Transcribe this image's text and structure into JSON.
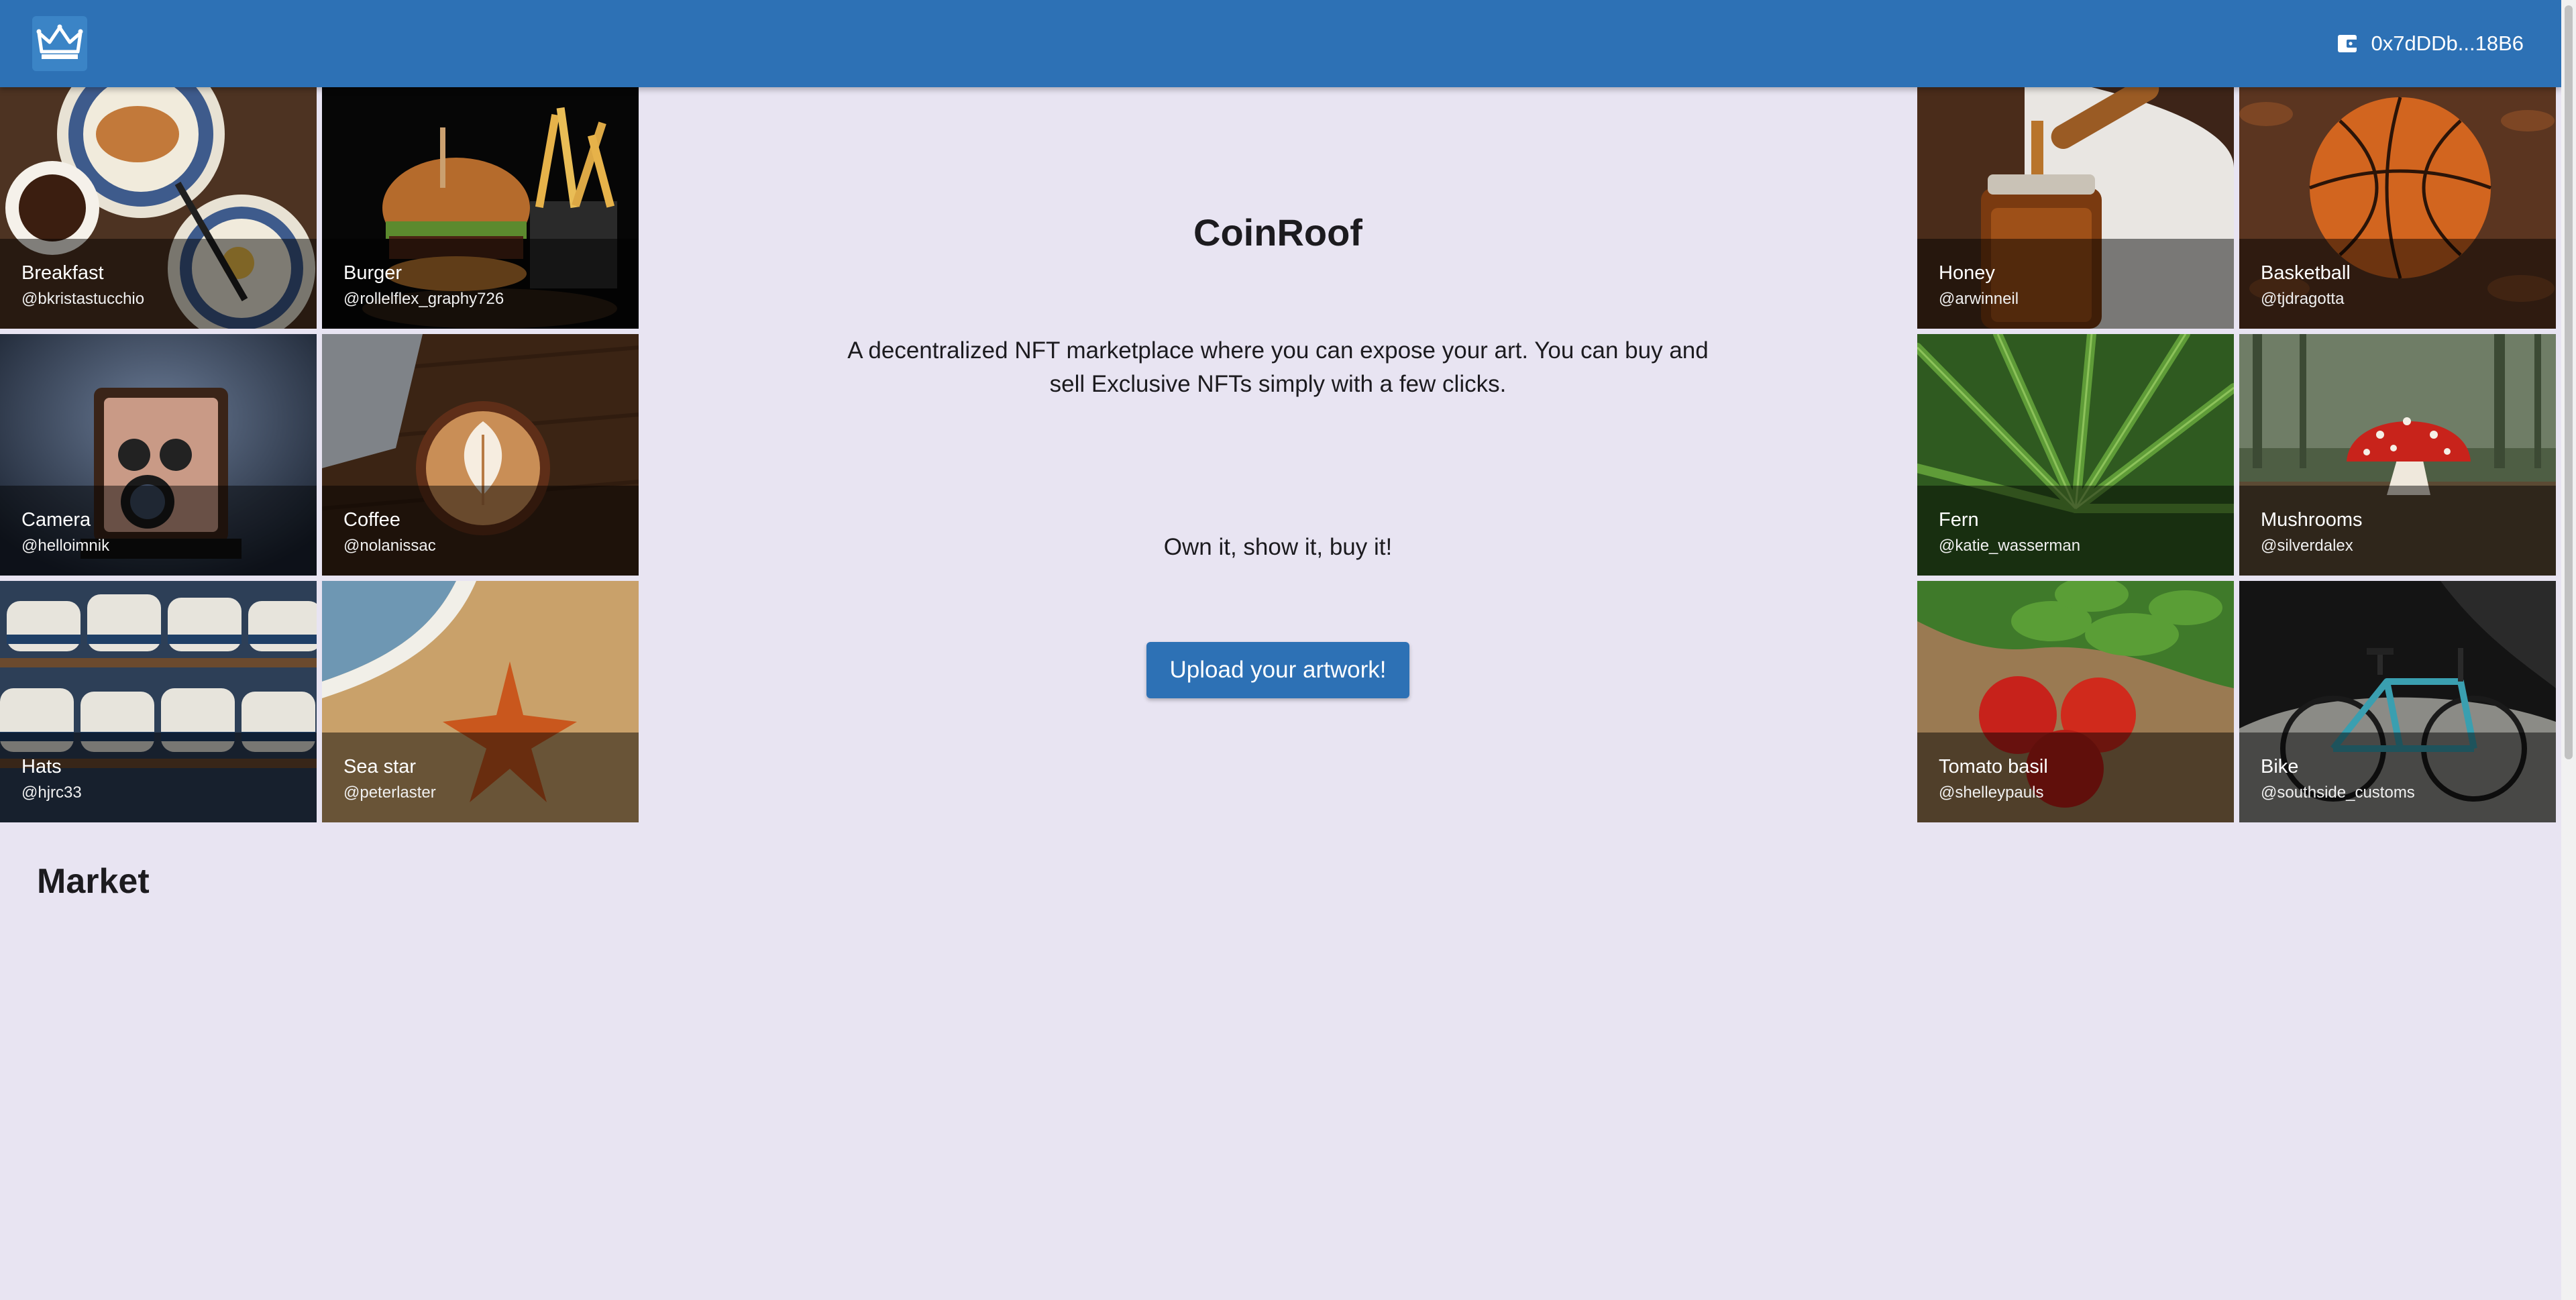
{
  "header": {
    "logo_icon": "crown-icon",
    "wallet_icon": "wallet-icon",
    "wallet_address": "0x7dDDb...18B6",
    "bar_color": "#2d71b5"
  },
  "hero": {
    "title": "CoinRoof",
    "description": "A decentralized NFT marketplace where you can expose your art. You can buy and sell Exclusive NFTs simply with a few clicks.",
    "tagline": "Own it, show it, buy it!",
    "upload_label": "Upload your artwork!"
  },
  "gallery_left": [
    {
      "title": "Breakfast",
      "author": "@bkristastucchio"
    },
    {
      "title": "Burger",
      "author": "@rollelflex_graphy726"
    },
    {
      "title": "Camera",
      "author": "@helloimnik"
    },
    {
      "title": "Coffee",
      "author": "@nolanissac"
    },
    {
      "title": "Hats",
      "author": "@hjrc33"
    },
    {
      "title": "Sea star",
      "author": "@peterlaster"
    }
  ],
  "gallery_right": [
    {
      "title": "Honey",
      "author": "@arwinneil"
    },
    {
      "title": "Basketball",
      "author": "@tjdragotta"
    },
    {
      "title": "Fern",
      "author": "@katie_wasserman"
    },
    {
      "title": "Mushrooms",
      "author": "@silverdalex"
    },
    {
      "title": "Tomato basil",
      "author": "@shelleypauls"
    },
    {
      "title": "Bike",
      "author": "@southside_customs"
    }
  ],
  "market": {
    "heading": "Market"
  }
}
